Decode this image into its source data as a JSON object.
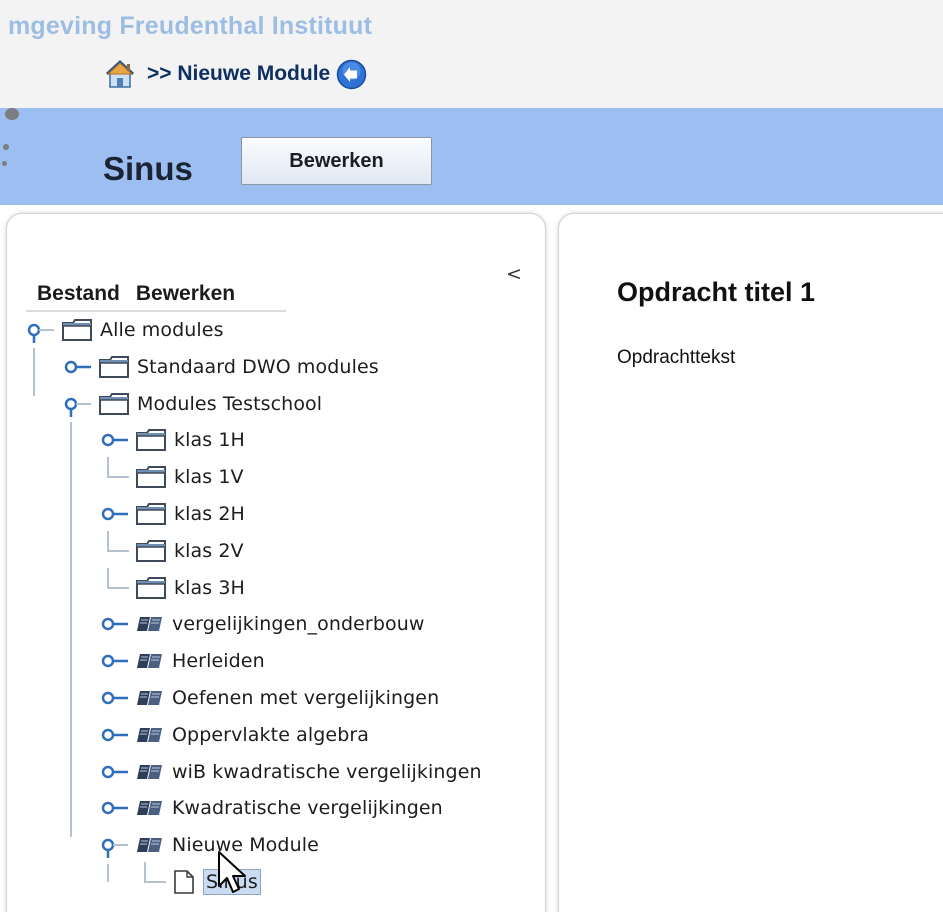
{
  "header": {
    "app_title": "mgeving  Freudenthal Instituut",
    "breadcrumb": ">> Nieuwe Module"
  },
  "toolbar": {
    "title": "Sinus",
    "edit_label": "Bewerken"
  },
  "menu": {
    "file": "Bestand",
    "edit": "Bewerken",
    "collapse": "<"
  },
  "tree": [
    {
      "label": "Alle modules",
      "icon": "folder-icon",
      "level": 0,
      "handle": "expanded"
    },
    {
      "label": "Standaard DWO modules",
      "icon": "folder-icon",
      "level": 1,
      "handle": "collapsed"
    },
    {
      "label": "Modules Testschool",
      "icon": "folder-icon",
      "level": 1,
      "handle": "expanded"
    },
    {
      "label": "klas 1H",
      "icon": "folder-icon",
      "level": 2,
      "handle": "collapsed"
    },
    {
      "label": "klas 1V",
      "icon": "folder-icon",
      "level": 2,
      "handle": "none"
    },
    {
      "label": "klas 2H",
      "icon": "folder-icon",
      "level": 2,
      "handle": "collapsed"
    },
    {
      "label": "klas 2V",
      "icon": "folder-icon",
      "level": 2,
      "handle": "none"
    },
    {
      "label": "klas 3H",
      "icon": "folder-icon",
      "level": 2,
      "handle": "none"
    },
    {
      "label": "vergelijkingen_onderbouw",
      "icon": "book-icon",
      "level": 2,
      "handle": "collapsed"
    },
    {
      "label": "Herleiden",
      "icon": "book-icon",
      "level": 2,
      "handle": "collapsed"
    },
    {
      "label": "Oefenen met vergelijkingen",
      "icon": "book-icon",
      "level": 2,
      "handle": "collapsed"
    },
    {
      "label": "Oppervlakte algebra",
      "icon": "book-icon",
      "level": 2,
      "handle": "collapsed"
    },
    {
      "label": "wiB kwadratische vergelijkingen",
      "icon": "book-icon",
      "level": 2,
      "handle": "collapsed"
    },
    {
      "label": "Kwadratische vergelijkingen",
      "icon": "book-icon",
      "level": 2,
      "handle": "collapsed"
    },
    {
      "label": "Nieuwe Module",
      "icon": "book-icon",
      "level": 2,
      "handle": "expanded"
    },
    {
      "label": "Sinus",
      "icon": "document-icon",
      "level": 3,
      "handle": "none",
      "selected": true
    }
  ],
  "content": {
    "title": "Opdracht titel 1",
    "text": "Opdrachttekst"
  },
  "colors": {
    "header_bg": "#f3f3f3",
    "toolbar_bg": "#9cbef0",
    "title_text": "#9dbde3",
    "breadcrumb_text": "#0d2f63",
    "selection": "#cbdcf2"
  }
}
